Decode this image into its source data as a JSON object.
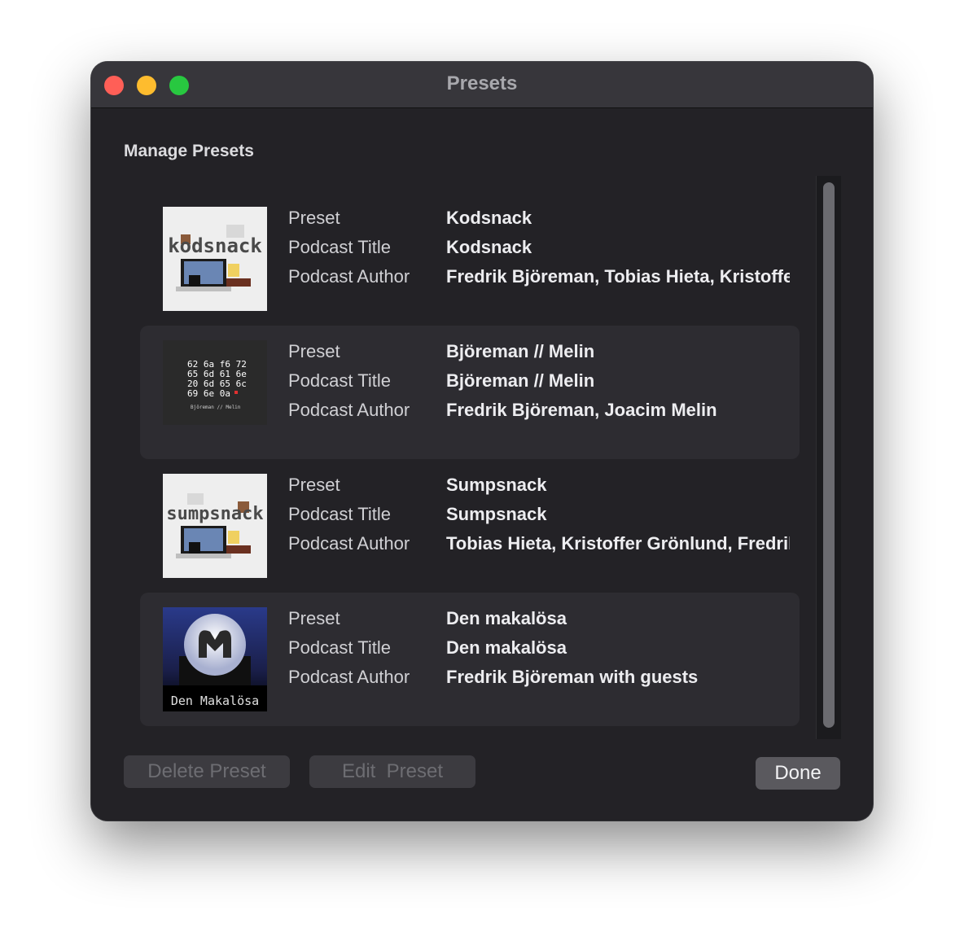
{
  "window": {
    "title": "Presets"
  },
  "section_title": "Manage Presets",
  "field_labels": {
    "preset": "Preset",
    "title": "Podcast Title",
    "author": "Podcast Author"
  },
  "presets": [
    {
      "preset": "Kodsnack",
      "title": "Kodsnack",
      "author": "Fredrik Björeman, Tobias Hieta, Kristoffer Grönlund",
      "artwork": {
        "text": "kodsnack"
      }
    },
    {
      "preset": "Björeman // Melin",
      "title": "Björeman // Melin",
      "author": "Fredrik Björeman, Joacim Melin",
      "artwork": {
        "hex_lines": [
          "62 6a f6 72",
          "65 6d 61 6e",
          "20 6d 65 6c",
          "69 6e 0a"
        ],
        "caption": "Björeman // Melin"
      }
    },
    {
      "preset": "Sumpsnack",
      "title": "Sumpsnack",
      "author": "Tobias Hieta, Kristoffer Grönlund, Fredrik Björeman",
      "artwork": {
        "text": "sumpsnack"
      }
    },
    {
      "preset": "Den makalösa",
      "title": "Den makalösa",
      "author": "Fredrik Björeman with guests",
      "artwork": {
        "caption": "Den Makalösa"
      }
    }
  ],
  "buttons": {
    "delete": "Delete Preset",
    "edit": "Edit  Preset",
    "done": "Done"
  },
  "colors": {
    "window_bg": "#232226",
    "titlebar": "#37363b",
    "close": "#ff5f57",
    "minimize": "#febc2e",
    "maximize": "#28c840",
    "row_alt": "#2d2c31"
  }
}
